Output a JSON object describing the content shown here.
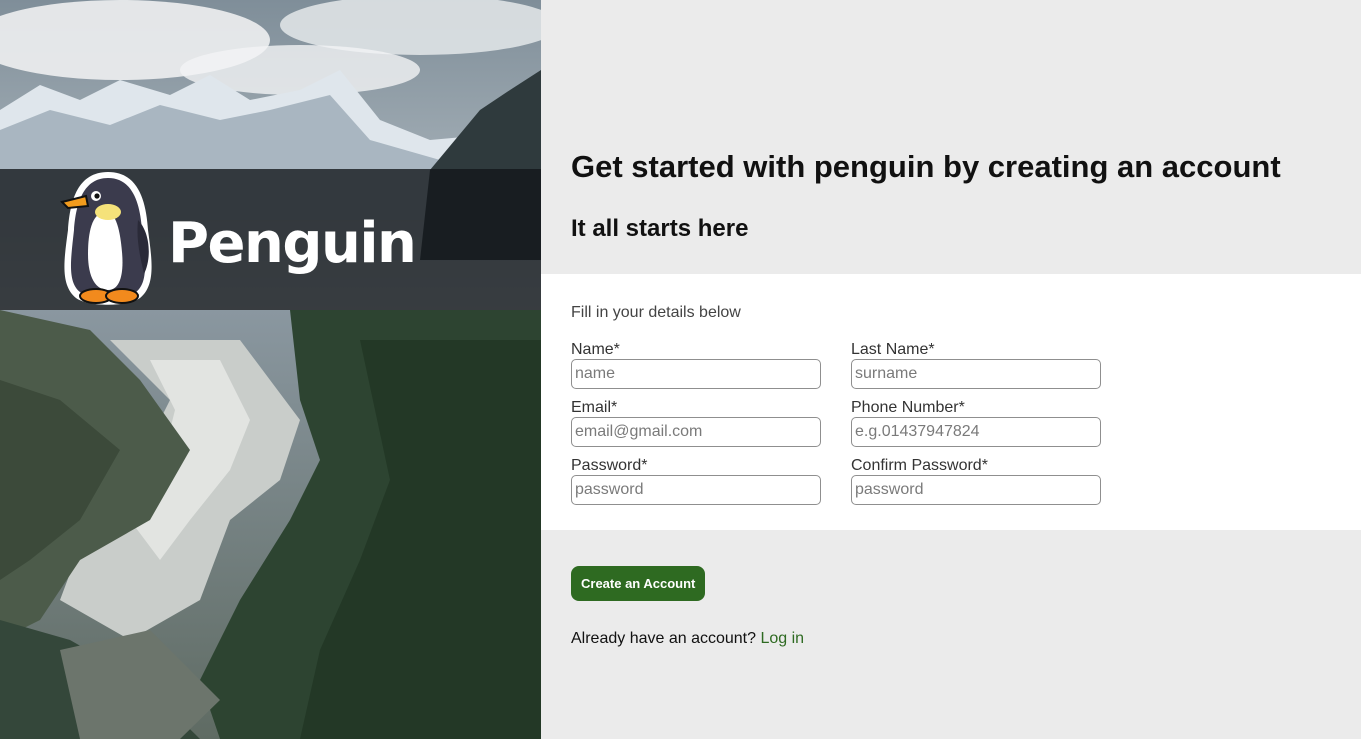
{
  "brand": {
    "name": "Penguin"
  },
  "main": {
    "title": "Get started with penguin by creating an account",
    "subtitle": "It all starts here"
  },
  "form": {
    "intro": "Fill in your details below",
    "fields": {
      "name": {
        "label": "Name*",
        "placeholder": "name",
        "value": ""
      },
      "last_name": {
        "label": "Last Name*",
        "placeholder": "surname",
        "value": ""
      },
      "email": {
        "label": "Email*",
        "placeholder": "email@gmail.com",
        "value": ""
      },
      "phone": {
        "label": "Phone Number*",
        "placeholder": "e.g.01437947824",
        "value": ""
      },
      "password": {
        "label": "Password*",
        "placeholder": "password",
        "value": ""
      },
      "confirm_password": {
        "label": "Confirm Password*",
        "placeholder": "password",
        "value": ""
      }
    },
    "submit_label": "Create an Account"
  },
  "login": {
    "prompt": "Already have an account?",
    "link_label": "Log in"
  },
  "colors": {
    "accent": "#2e6a21",
    "page_bg": "#ebebeb",
    "card_bg": "#ffffff",
    "brand_band": "#12161a"
  }
}
